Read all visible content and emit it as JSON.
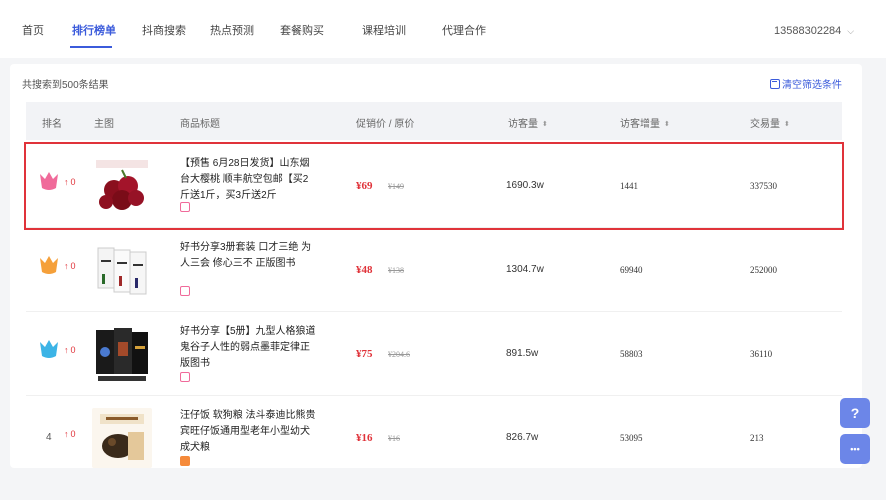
{
  "nav": {
    "items": [
      "首页",
      "排行榜单",
      "抖商搜索",
      "热点预测",
      "套餐购买",
      "课程培训",
      "代理合作"
    ],
    "active_index": 1,
    "user_phone": "13588302284",
    "user_chevron": "chevron-down-icon"
  },
  "results": {
    "count_text": "共搜索到500条结果",
    "clear_filter_label": "清空筛选条件",
    "clear_filter_icon": "trash-icon"
  },
  "table": {
    "headers": {
      "rank": "排名",
      "image": "主图",
      "title": "商品标题",
      "price": "促销价 / 原价",
      "visits": "访客量",
      "visit_increase": "访客增量",
      "trades": "交易量"
    },
    "sort_glyph": "⬍",
    "rows": [
      {
        "rank": "",
        "badge_color": "#f06a9a",
        "trend": "0",
        "title": "【预售 6月28日发货】山东烟台大樱桃 顺丰航空包邮【买2斤送1斤，买3斤送2斤",
        "shop_tag_color": "#f06a9a",
        "price": "¥69",
        "orig_price": "¥149",
        "visits": "1690.3w",
        "visit_increase": "1441",
        "trades": "337530",
        "highlighted": true
      },
      {
        "rank": "",
        "badge_color": "#f5a03a",
        "trend": "0",
        "title": "好书分享3册套装 口才三绝 为人三会 修心三不 正版图书",
        "shop_tag_color": "#f06a9a",
        "price": "¥48",
        "orig_price": "¥138",
        "visits": "1304.7w",
        "visit_increase": "69940",
        "trades": "252000",
        "highlighted": false
      },
      {
        "rank": "",
        "badge_color": "#3cb4e6",
        "trend": "0",
        "title": "好书分享【5册】九型人格狼道鬼谷子人性的弱点墨菲定律正版图书",
        "shop_tag_color": "#f06a9a",
        "price": "¥75",
        "orig_price": "¥204.6",
        "visits": "891.5w",
        "visit_increase": "58803",
        "trades": "36110",
        "highlighted": false
      },
      {
        "rank": "4",
        "badge_color": "",
        "trend": "0",
        "title": "汪仔饭 软狗粮 法斗泰迪比熊贵宾旺仔饭通用型老年小型幼犬成犬粮",
        "shop_tag_color": "#f58a3a",
        "price": "¥16",
        "orig_price": "¥16",
        "visits": "826.7w",
        "visit_increase": "53095",
        "trades": "213",
        "highlighted": false
      }
    ]
  },
  "floating": {
    "help_icon": "question-icon",
    "help_glyph": "?",
    "chat_icon": "chat-icon",
    "chat_glyph": "•••"
  }
}
